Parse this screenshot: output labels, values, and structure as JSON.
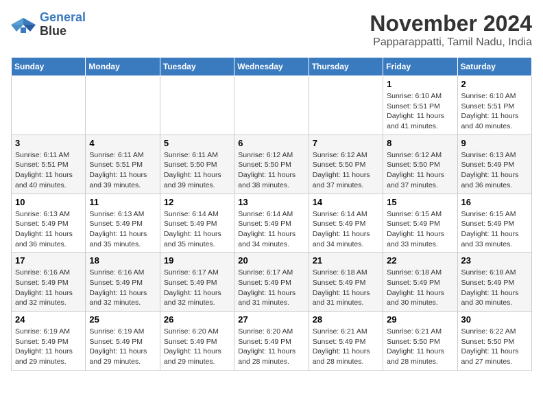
{
  "header": {
    "logo_line1": "General",
    "logo_line2": "Blue",
    "title": "November 2024",
    "subtitle": "Papparappatti, Tamil Nadu, India"
  },
  "weekdays": [
    "Sunday",
    "Monday",
    "Tuesday",
    "Wednesday",
    "Thursday",
    "Friday",
    "Saturday"
  ],
  "weeks": [
    [
      {
        "day": "",
        "info": ""
      },
      {
        "day": "",
        "info": ""
      },
      {
        "day": "",
        "info": ""
      },
      {
        "day": "",
        "info": ""
      },
      {
        "day": "",
        "info": ""
      },
      {
        "day": "1",
        "info": "Sunrise: 6:10 AM\nSunset: 5:51 PM\nDaylight: 11 hours\nand 41 minutes."
      },
      {
        "day": "2",
        "info": "Sunrise: 6:10 AM\nSunset: 5:51 PM\nDaylight: 11 hours\nand 40 minutes."
      }
    ],
    [
      {
        "day": "3",
        "info": "Sunrise: 6:11 AM\nSunset: 5:51 PM\nDaylight: 11 hours\nand 40 minutes."
      },
      {
        "day": "4",
        "info": "Sunrise: 6:11 AM\nSunset: 5:51 PM\nDaylight: 11 hours\nand 39 minutes."
      },
      {
        "day": "5",
        "info": "Sunrise: 6:11 AM\nSunset: 5:50 PM\nDaylight: 11 hours\nand 39 minutes."
      },
      {
        "day": "6",
        "info": "Sunrise: 6:12 AM\nSunset: 5:50 PM\nDaylight: 11 hours\nand 38 minutes."
      },
      {
        "day": "7",
        "info": "Sunrise: 6:12 AM\nSunset: 5:50 PM\nDaylight: 11 hours\nand 37 minutes."
      },
      {
        "day": "8",
        "info": "Sunrise: 6:12 AM\nSunset: 5:50 PM\nDaylight: 11 hours\nand 37 minutes."
      },
      {
        "day": "9",
        "info": "Sunrise: 6:13 AM\nSunset: 5:49 PM\nDaylight: 11 hours\nand 36 minutes."
      }
    ],
    [
      {
        "day": "10",
        "info": "Sunrise: 6:13 AM\nSunset: 5:49 PM\nDaylight: 11 hours\nand 36 minutes."
      },
      {
        "day": "11",
        "info": "Sunrise: 6:13 AM\nSunset: 5:49 PM\nDaylight: 11 hours\nand 35 minutes."
      },
      {
        "day": "12",
        "info": "Sunrise: 6:14 AM\nSunset: 5:49 PM\nDaylight: 11 hours\nand 35 minutes."
      },
      {
        "day": "13",
        "info": "Sunrise: 6:14 AM\nSunset: 5:49 PM\nDaylight: 11 hours\nand 34 minutes."
      },
      {
        "day": "14",
        "info": "Sunrise: 6:14 AM\nSunset: 5:49 PM\nDaylight: 11 hours\nand 34 minutes."
      },
      {
        "day": "15",
        "info": "Sunrise: 6:15 AM\nSunset: 5:49 PM\nDaylight: 11 hours\nand 33 minutes."
      },
      {
        "day": "16",
        "info": "Sunrise: 6:15 AM\nSunset: 5:49 PM\nDaylight: 11 hours\nand 33 minutes."
      }
    ],
    [
      {
        "day": "17",
        "info": "Sunrise: 6:16 AM\nSunset: 5:49 PM\nDaylight: 11 hours\nand 32 minutes."
      },
      {
        "day": "18",
        "info": "Sunrise: 6:16 AM\nSunset: 5:49 PM\nDaylight: 11 hours\nand 32 minutes."
      },
      {
        "day": "19",
        "info": "Sunrise: 6:17 AM\nSunset: 5:49 PM\nDaylight: 11 hours\nand 32 minutes."
      },
      {
        "day": "20",
        "info": "Sunrise: 6:17 AM\nSunset: 5:49 PM\nDaylight: 11 hours\nand 31 minutes."
      },
      {
        "day": "21",
        "info": "Sunrise: 6:18 AM\nSunset: 5:49 PM\nDaylight: 11 hours\nand 31 minutes."
      },
      {
        "day": "22",
        "info": "Sunrise: 6:18 AM\nSunset: 5:49 PM\nDaylight: 11 hours\nand 30 minutes."
      },
      {
        "day": "23",
        "info": "Sunrise: 6:18 AM\nSunset: 5:49 PM\nDaylight: 11 hours\nand 30 minutes."
      }
    ],
    [
      {
        "day": "24",
        "info": "Sunrise: 6:19 AM\nSunset: 5:49 PM\nDaylight: 11 hours\nand 29 minutes."
      },
      {
        "day": "25",
        "info": "Sunrise: 6:19 AM\nSunset: 5:49 PM\nDaylight: 11 hours\nand 29 minutes."
      },
      {
        "day": "26",
        "info": "Sunrise: 6:20 AM\nSunset: 5:49 PM\nDaylight: 11 hours\nand 29 minutes."
      },
      {
        "day": "27",
        "info": "Sunrise: 6:20 AM\nSunset: 5:49 PM\nDaylight: 11 hours\nand 28 minutes."
      },
      {
        "day": "28",
        "info": "Sunrise: 6:21 AM\nSunset: 5:49 PM\nDaylight: 11 hours\nand 28 minutes."
      },
      {
        "day": "29",
        "info": "Sunrise: 6:21 AM\nSunset: 5:50 PM\nDaylight: 11 hours\nand 28 minutes."
      },
      {
        "day": "30",
        "info": "Sunrise: 6:22 AM\nSunset: 5:50 PM\nDaylight: 11 hours\nand 27 minutes."
      }
    ]
  ]
}
